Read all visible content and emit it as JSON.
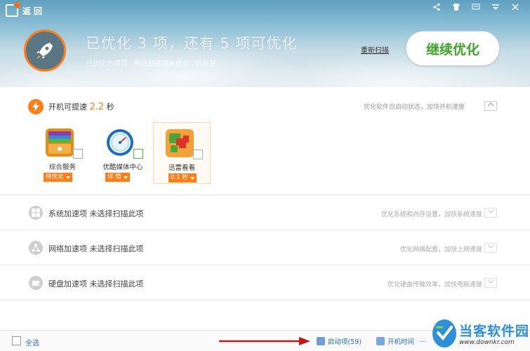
{
  "header": {
    "back_label": "返回",
    "headline": "已优化 3 项，还有 5 项可优化",
    "subline": [
      "已优化的项目",
      "系统加速项未优化",
      "可恢复"
    ],
    "rescan_label": "重新扫描",
    "continue_label": "继续优化",
    "window_icons": [
      "share-icon",
      "skin-icon",
      "message-icon",
      "menu-icon",
      "close-icon"
    ]
  },
  "boot": {
    "title_prefix": "开机可提速",
    "seconds": "2.2",
    "unit": "秒",
    "description": "优化软件自启动状态，加快开机速度",
    "collapse_label": "⌃",
    "items": [
      {
        "name": "综合服务",
        "dropdown": "待优化",
        "icon": "service-icon"
      },
      {
        "name": "优酷媒体中心",
        "dropdown": "详 情",
        "icon": "youku-media-icon"
      },
      {
        "name": "迅雷看看",
        "dropdown": "0.1 秒",
        "icon": "xunlei-kankan-icon"
      }
    ]
  },
  "sections": [
    {
      "title": "系统加速项 未选择扫描此项",
      "description": "优化系统和内存设置，加快系统速度",
      "icon": "windows-icon"
    },
    {
      "title": "网络加速项 未选择扫描此项",
      "description": "优化网络配置，加快上网速度",
      "icon": "network-icon"
    },
    {
      "title": "硬盘加速项 未选择扫描此项",
      "description": "优化硬盘传输效率，加快电脑速度",
      "icon": "harddisk-icon"
    }
  ],
  "footer": {
    "select_all": "全选",
    "startup_items": "启动项(59)",
    "boot_time": "开机时间",
    "extra": "…"
  },
  "watermark": {
    "main": "当客软件园",
    "sub": "www.downkr.com"
  },
  "colors": {
    "accent": "#ff7e1a",
    "green": "#3fa52a",
    "link": "#2a6bb8"
  }
}
